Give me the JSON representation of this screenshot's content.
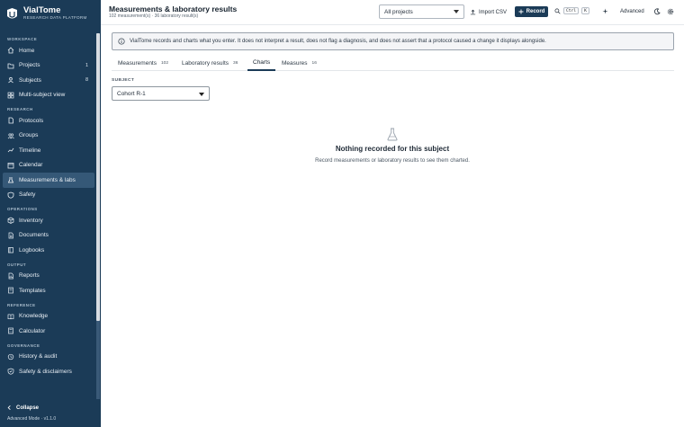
{
  "app": {
    "name": "VialTome",
    "tagline": "RESEARCH DATA PLATFORM"
  },
  "sidebar": {
    "sections": [
      {
        "label": "WORKSPACE",
        "items": [
          {
            "label": "Home",
            "icon": "home-icon"
          },
          {
            "label": "Projects",
            "icon": "folder-icon",
            "count": "1"
          },
          {
            "label": "Subjects",
            "icon": "subjects-icon",
            "count": "8"
          },
          {
            "label": "Multi-subject view",
            "icon": "grid-icon"
          }
        ]
      },
      {
        "label": "RESEARCH",
        "items": [
          {
            "label": "Protocols",
            "icon": "document-icon"
          },
          {
            "label": "Groups",
            "icon": "groups-icon"
          },
          {
            "label": "Timeline",
            "icon": "timeline-icon"
          },
          {
            "label": "Calendar",
            "icon": "calendar-icon"
          },
          {
            "label": "Measurements & labs",
            "icon": "flask-icon",
            "active": true
          },
          {
            "label": "Safety",
            "icon": "shield-icon"
          }
        ]
      },
      {
        "label": "OPERATIONS",
        "items": [
          {
            "label": "Inventory",
            "icon": "box-icon"
          },
          {
            "label": "Documents",
            "icon": "file-icon"
          },
          {
            "label": "Logbooks",
            "icon": "book-icon"
          }
        ]
      },
      {
        "label": "OUTPUT",
        "items": [
          {
            "label": "Reports",
            "icon": "report-icon"
          },
          {
            "label": "Templates",
            "icon": "template-icon"
          }
        ]
      },
      {
        "label": "REFERENCE",
        "items": [
          {
            "label": "Knowledge",
            "icon": "book-open-icon"
          },
          {
            "label": "Calculator",
            "icon": "calculator-icon"
          }
        ]
      },
      {
        "label": "GOVERNANCE",
        "items": [
          {
            "label": "History & audit",
            "icon": "history-icon"
          },
          {
            "label": "Safety & disclaimers",
            "icon": "shield-check-icon"
          }
        ]
      }
    ],
    "collapse_label": "Collapse",
    "mode_label": "Advanced Mode · v1.1.0"
  },
  "header": {
    "title": "Measurements & laboratory results",
    "subtitle": "102 measurement(s) · 36 laboratory result(s)",
    "project_select": "All projects",
    "import_label": "Import CSV",
    "record_label": "Record",
    "shortcut_keys": [
      "Ctrl",
      "K"
    ],
    "advanced_label": "Advanced"
  },
  "notice": {
    "text": "VialTome records and charts what you enter. It does not interpret a result, does not flag a diagnosis, and does not assert that a protocol caused a change it displays alongside."
  },
  "tabs": [
    {
      "label": "Measurements",
      "badge": "102"
    },
    {
      "label": "Laboratory results",
      "badge": "36"
    },
    {
      "label": "Charts",
      "badge": "",
      "active": true
    },
    {
      "label": "Measures",
      "badge": "16"
    }
  ],
  "subject": {
    "label": "SUBJECT",
    "value": "Cohort R-1"
  },
  "empty_state": {
    "title": "Nothing recorded for this subject",
    "subtitle": "Record measurements or laboratory results to see them charted."
  },
  "colors": {
    "sidebar_bg": "#1b3b57",
    "active_item": "#355877",
    "primary": "#1b3b57"
  }
}
